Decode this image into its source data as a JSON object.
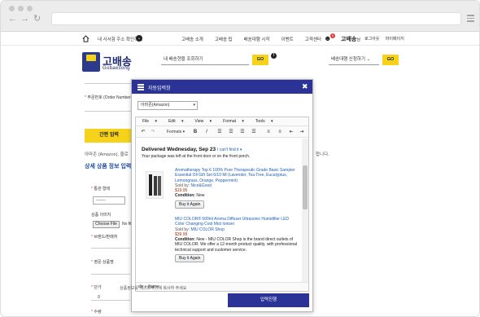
{
  "topnav": {
    "address_label": "내 사서함 주소 확인하기",
    "links": [
      "고배송 소개",
      "고배송 팁",
      "배송대행 시작",
      "이벤트",
      "고객센터"
    ],
    "user_badge": "0",
    "user_name": "고배송",
    "user_suffix": "님",
    "logout": "로그아웃",
    "mypage": "마이페이지"
  },
  "logo": {
    "title": "고배송",
    "subtitle": "Gobaesong"
  },
  "header": {
    "search_placeholder": "내 배송현황 조회하기",
    "go_label": "GO",
    "service_select": "배송대행 신청하기",
    "go2_label": "GO"
  },
  "form": {
    "order_label": "주문번호 (Order Number",
    "quick_input_label": "간편 입력",
    "amazon_text_left": "아마존 (Amazon), 줄로",
    "amazon_text_right": "합니다.",
    "section_title": "상세 상품 정보 입력하",
    "customs_label": "통관 형태",
    "customs_select": "-------",
    "product_image_label": "상품 이미지",
    "file_button": "Choose File",
    "file_status": "No file",
    "brand_label": "브랜드/판매처",
    "product_name_label": "영문 상품명",
    "unit_price_label": "단가",
    "unit_price_value": "0",
    "quantity_label": "수량",
    "note": "상품정보를 텍스트박스에 복사하 주세요"
  },
  "modal": {
    "title": "자동입력창",
    "source_select": "아마존(Amazon)",
    "menubar": [
      "File",
      "Edit",
      "View",
      "Format",
      "Tools"
    ],
    "formats_label": "Formats",
    "delivery_title": "Delivered Wednesday, Sep 23",
    "cant_find": "I can't find it",
    "delivery_sub": "Your package was left at the front door or on the front porch.",
    "items": [
      {
        "title": "Aromatherapy Top 6 100% Pure Therapeutic Grade Basic Sampler Essential Oil Gift Set 6/10 Ml (Lavender, Tea Tree, Eucalyptus, Lemongrass, Orange, Peppermint)",
        "sold_by_prefix": "Sold by: ",
        "sold_by": "Nice&Good",
        "price": "$19.95",
        "condition_label": "Condition:",
        "condition": "New",
        "button": "Buy it Again"
      },
      {
        "title": "MIU COLOR® 500ml Aroma Diffuser Ultrasonic Humidifier LED Color Changing Cool Mist Ionizer",
        "sold_by_prefix": "Sold by: ",
        "sold_by": "MIU COLOR Shop",
        "price": "$39.99",
        "condition_label": "Condition:",
        "condition": "New - MIU COLOR Shop is the brand direct outlets of MIU COLOR. We offer a 12-month product quality, with professional technical support and customer service.",
        "button": "Buy it Again"
      }
    ],
    "status_path": "div » iframe",
    "submit": "입력진행"
  },
  "colors": {
    "accent_navy": "#2b3496",
    "brand_yellow": "#f6d31a",
    "link_blue": "#1f5fb3",
    "price_red": "#b12704"
  }
}
